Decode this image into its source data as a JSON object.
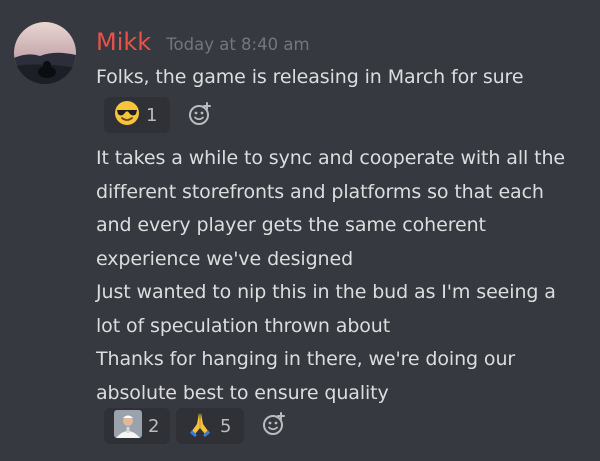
{
  "message": {
    "author": "Mikk",
    "timestamp": "Today at 8:40 am",
    "first_line": "Folks, the game is releasing in March for sure",
    "body_lines": [
      "It takes a while to sync and cooperate with all the",
      "different storefronts and platforms so that each",
      "and every player gets the same coherent",
      "experience we've designed",
      "Just wanted to nip this in the bud as I'm seeing a",
      "lot of speculation thrown about",
      "Thanks for hanging in there, we're doing our",
      "absolute best to ensure quality"
    ]
  },
  "reactions_first": [
    {
      "icon": "sunglasses-emoji-icon",
      "count": "1"
    }
  ],
  "reactions_second": [
    {
      "icon": "pope-emoji-icon",
      "count": "2"
    },
    {
      "icon": "praying-hands-emoji-icon",
      "count": "5"
    }
  ],
  "colors": {
    "background": "#36393f",
    "username": "#e8524a",
    "timestamp": "#72767d",
    "text": "#dcddde",
    "reaction_bg": "#2f3136"
  }
}
